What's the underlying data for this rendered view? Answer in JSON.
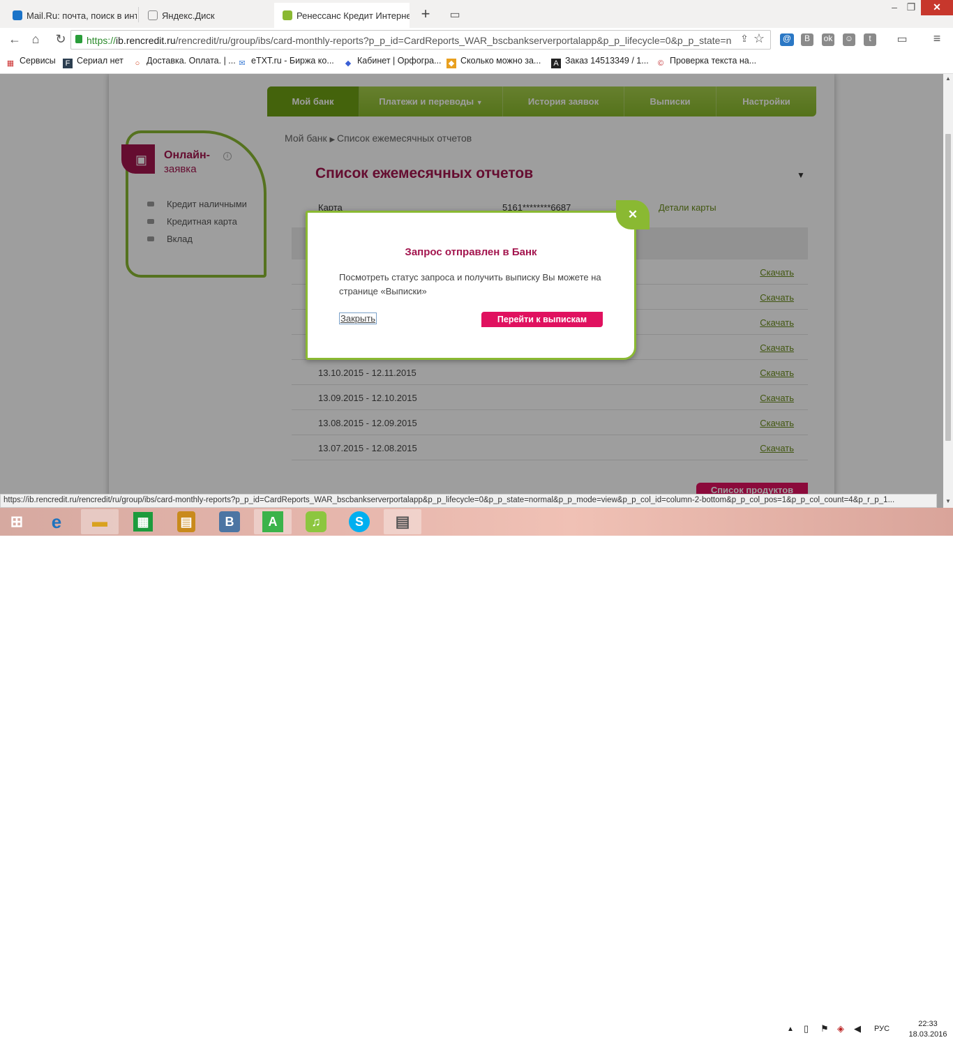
{
  "tabs": [
    {
      "title": "Mail.Ru: почта, поиск в инте"
    },
    {
      "title": "Яндекс.Диск"
    },
    {
      "title": "Ренессанс Кредит Интернет"
    }
  ],
  "address": {
    "scheme": "https://",
    "host": "ib.rencredit.ru",
    "path": "/rencredit/ru/group/ibs/card-monthly-reports?p_p_id=CardReports_WAR_bscbankserverportalapp&p_p_lifecycle=0&p_p_state=n"
  },
  "bookmarks": [
    "Сервисы",
    "Сериал нет",
    "Доставка. Оплата. | ...",
    "eTXT.ru - Биржа ко...",
    "Кабинет | Орфогра...",
    "Сколько можно за...",
    "Заказ 14513349 / 1...",
    "Проверка текста на..."
  ],
  "nav": [
    "Мой банк",
    "Платежи и переводы",
    "История заявок",
    "Выписки",
    "Настройки"
  ],
  "sidebar": {
    "title1": "Онлайн-",
    "title2": "заявка",
    "links": [
      "Кредит наличными",
      "Кредитная карта",
      "Вклад"
    ]
  },
  "breadcrumb": {
    "root": "Мой банк",
    "current": "Список ежемесячных отчетов"
  },
  "page_title": "Список ежемесячных отчетов",
  "card": {
    "label": "Карта",
    "number": "5161********6687",
    "details": "Детали карты"
  },
  "reports": [
    {
      "period": "",
      "action": "Скачать"
    },
    {
      "period": "",
      "action": "Скачать"
    },
    {
      "period": "",
      "action": "Скачать"
    },
    {
      "period": "",
      "action": "Скачать"
    },
    {
      "period": "13.10.2015 - 12.11.2015",
      "action": "Скачать"
    },
    {
      "period": "13.09.2015 - 12.10.2015",
      "action": "Скачать"
    },
    {
      "period": "13.08.2015 - 12.09.2015",
      "action": "Скачать"
    },
    {
      "period": "13.07.2015 - 12.08.2015",
      "action": "Скачать"
    }
  ],
  "products_button": "Список продуктов",
  "modal": {
    "title": "Запрос отправлен в Банк",
    "text": "Посмотреть статус запроса и получить выписку Вы можете на странице «Выписки»",
    "close": "Закрыть",
    "go": "Перейти к выпискам"
  },
  "status_url": "https://ib.rencredit.ru/rencredit/ru/group/ibs/card-monthly-reports?p_p_id=CardReports_WAR_bscbankserverportalapp&p_p_lifecycle=0&p_p_state=normal&p_p_mode=view&p_p_col_id=column-2-bottom&p_p_col_pos=1&p_p_col_count=4&p_r_p_1...",
  "tray": {
    "lang": "РУС",
    "time": "22:33",
    "date": "18.03.2016"
  },
  "colors": {
    "green": "#8ab932",
    "magenta": "#a3154e",
    "pink_button": "#e0115f"
  }
}
